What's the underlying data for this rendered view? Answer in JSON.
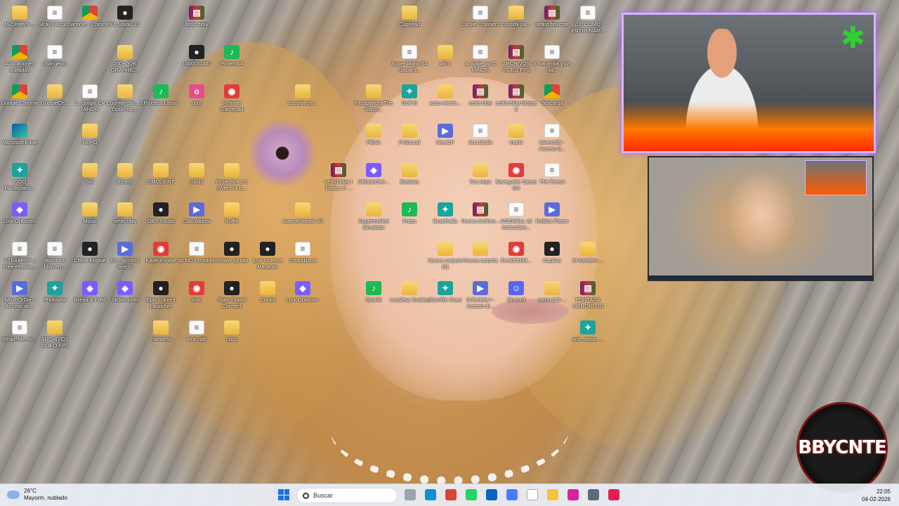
{
  "desktop": {
    "icons": [
      {
        "label": "M-Centers-...",
        "type": "folder"
      },
      {
        "label": "Stray - Acce...",
        "type": "doc"
      },
      {
        "label": "vicente - Chrome",
        "type": "chrome"
      },
      {
        "label": "FL Studio 21",
        "type": "dark"
      },
      {
        "label": "setlis bbiy",
        "type": "rar"
      },
      {
        "label": "Cuphead",
        "type": "folder"
      },
      {
        "label": "Castle Crashers",
        "type": "doc"
      },
      {
        "label": "coopdx-pa...",
        "type": "folder"
      },
      {
        "label": "setlist bbycnte",
        "type": "rar"
      },
      {
        "label": "03. COMO ENTRENAR...",
        "type": "doc"
      },
      {
        "label": "Aplicaciones quitadas",
        "type": "chrome"
      },
      {
        "label": "changelog",
        "type": "doc"
      },
      {
        "label": "200+ Y2K GRAPHIC...",
        "type": "folder"
      },
      {
        "label": "1000010467",
        "type": "dark"
      },
      {
        "label": "Project64",
        "type": "green"
      },
      {
        "label": "Super Mario 64 (Japan)...",
        "type": "doc"
      },
      {
        "label": "wii u",
        "type": "folder"
      },
      {
        "label": "4. wake up C MiNOR",
        "type": "doc"
      },
      {
        "label": "ARCHIVOS VIDEO FPS",
        "type": "rar"
      },
      {
        "label": "3. karambit ysvs nia...",
        "type": "doc"
      },
      {
        "label": "Google Chrome",
        "type": "chrome"
      },
      {
        "label": "GoogleCh...",
        "type": "folder"
      },
      {
        "label": "1. obygirl C# MiNOR",
        "type": "doc"
      },
      {
        "label": "Counter-Stri... 2 OptiProje...",
        "type": "folder"
      },
      {
        "label": "Process Lasso",
        "type": "green"
      },
      {
        "label": "osu!",
        "type": "pink"
      },
      {
        "label": "Remote Gamepad",
        "type": "red"
      },
      {
        "label": "coopdx-pa...",
        "type": "folder"
      },
      {
        "label": "Passpartout The Starvi...",
        "type": "folder"
      },
      {
        "label": "Golf It!",
        "type": "teal"
      },
      {
        "label": "yuzu-windo...",
        "type": "folder"
      },
      {
        "label": "setlis bbiy",
        "type": "rar"
      },
      {
        "label": "setlist bbiy bloque 2",
        "type": "rar"
      },
      {
        "label": "descarga",
        "type": "chrome"
      },
      {
        "label": "Microsoft Edge",
        "type": "edge"
      },
      {
        "label": "REPO",
        "type": "folder"
      },
      {
        "label": "PEAK",
        "type": "folder"
      },
      {
        "label": "FxSound",
        "type": "folder"
      },
      {
        "label": "NewCP",
        "type": "exe"
      },
      {
        "label": "Snowballs",
        "type": "doc"
      },
      {
        "label": "mario",
        "type": "folder"
      },
      {
        "label": "Minecraft - Acceso d...",
        "type": "doc"
      },
      {
        "label": "PIGO PARKclass...",
        "type": "teal"
      },
      {
        "label": "bin",
        "type": "folder"
      },
      {
        "label": "assets",
        "type": "folder"
      },
      {
        "label": "CMCLIENT",
        "type": "folder"
      },
      {
        "label": "mods",
        "type": "folder"
      },
      {
        "label": "Project64 1.6 (Wermi's b...",
        "type": "folder"
      },
      {
        "label": "setlist bbiy I bloque 6 ...",
        "type": "rar"
      },
      {
        "label": "SKlauncher...",
        "type": "purple"
      },
      {
        "label": "Basicos",
        "type": "folder"
      },
      {
        "label": "ftos miya",
        "type": "folder"
      },
      {
        "label": "Navegador Opera GX",
        "type": "red"
      },
      {
        "label": "The Forest",
        "type": "doc"
      },
      {
        "label": "Logi Options+",
        "type": "purple"
      },
      {
        "label": "Music",
        "type": "folder"
      },
      {
        "label": "setlis obiy",
        "type": "folder"
      },
      {
        "label": "OBS Studio",
        "type": "dark"
      },
      {
        "label": "Calculadora",
        "type": "exe"
      },
      {
        "label": "Ruffle",
        "type": "folder"
      },
      {
        "label": "JuanseUnlock V3",
        "type": "folder"
      },
      {
        "label": "Supermarket Simulator",
        "type": "folder"
      },
      {
        "label": "Fraps",
        "type": "green"
      },
      {
        "label": "Brawlhalla",
        "type": "teal"
      },
      {
        "label": "Nuevo Archivo...",
        "type": "rar"
      },
      {
        "label": "ASIO4ALL v2 Instruction...",
        "type": "doc"
      },
      {
        "label": "Roblox Player",
        "type": "exe"
      },
      {
        "label": "STEAMRIP » Free Pre-ins...",
        "type": "doc"
      },
      {
        "label": "Bbminor bbycen...",
        "type": "doc"
      },
      {
        "label": "Cheat Engine",
        "type": "dark"
      },
      {
        "label": "crx - Acceso directo",
        "type": "exe"
      },
      {
        "label": "Kade Engine",
        "type": "red"
      },
      {
        "label": "do NOT readme",
        "type": "doc"
      },
      {
        "label": "Roblox Studio",
        "type": "dark"
      },
      {
        "label": "iLok License Manager",
        "type": "dark"
      },
      {
        "label": "Chandiluna",
        "type": "doc"
      },
      {
        "label": "Nueva carpeta (2)",
        "type": "folder"
      },
      {
        "label": "Nueva carpeta",
        "type": "folder"
      },
      {
        "label": "fbeddf4935...",
        "type": "red"
      },
      {
        "label": "CapCut",
        "type": "dark"
      },
      {
        "label": "M-Centers-...",
        "type": "folder"
      },
      {
        "label": "MoveOrDie - Acceso dir...",
        "type": "exe"
      },
      {
        "label": "Photopea",
        "type": "teal"
      },
      {
        "label": "Bread & Fred",
        "type": "purple"
      },
      {
        "label": "SKlauncher",
        "type": "purple"
      },
      {
        "label": "Epic Games Launcher",
        "type": "dark"
      },
      {
        "label": "icon",
        "type": "red"
      },
      {
        "label": "Slate Digital Connect",
        "type": "dark"
      },
      {
        "label": "Config",
        "type": "folder"
      },
      {
        "label": "Logi Options+",
        "type": "purple"
      },
      {
        "label": "Spotify",
        "type": "green"
      },
      {
        "label": "Lossless Scaling",
        "type": "folder"
      },
      {
        "label": "Stumble Guys",
        "type": "teal"
      },
      {
        "label": "Schedule I - Acceso di...",
        "type": "exe"
      },
      {
        "label": "Discord",
        "type": "discord"
      },
      {
        "label": "cemu-2.6-...",
        "type": "folder"
      },
      {
        "label": "PORTADA MEMORI UU",
        "type": "rar"
      },
      {
        "label": "Read_Me_In...",
        "type": "doc"
      },
      {
        "label": "ARCHIVOS VIDEO FPS",
        "type": "folder"
      },
      {
        "label": "manifest",
        "type": "folder"
      },
      {
        "label": "lime.ndll",
        "type": "doc"
      },
      {
        "label": "Logs",
        "type": "folder"
      },
      {
        "label": "nox_setup_...",
        "type": "teal"
      }
    ]
  },
  "overlay": {
    "logo_text": "BBYCNTE"
  },
  "taskbar": {
    "weather_temp": "26°C",
    "weather_desc": "Mayorm. nublado",
    "search_placeholder": "Buscar",
    "time": "22:05",
    "date": "04-02-2026",
    "apps": [
      "file-explorer",
      "edge",
      "chrome",
      "whatsapp",
      "outlook",
      "copilot",
      "notepad",
      "folder",
      "instagram",
      "steam",
      "opera-gx"
    ]
  }
}
